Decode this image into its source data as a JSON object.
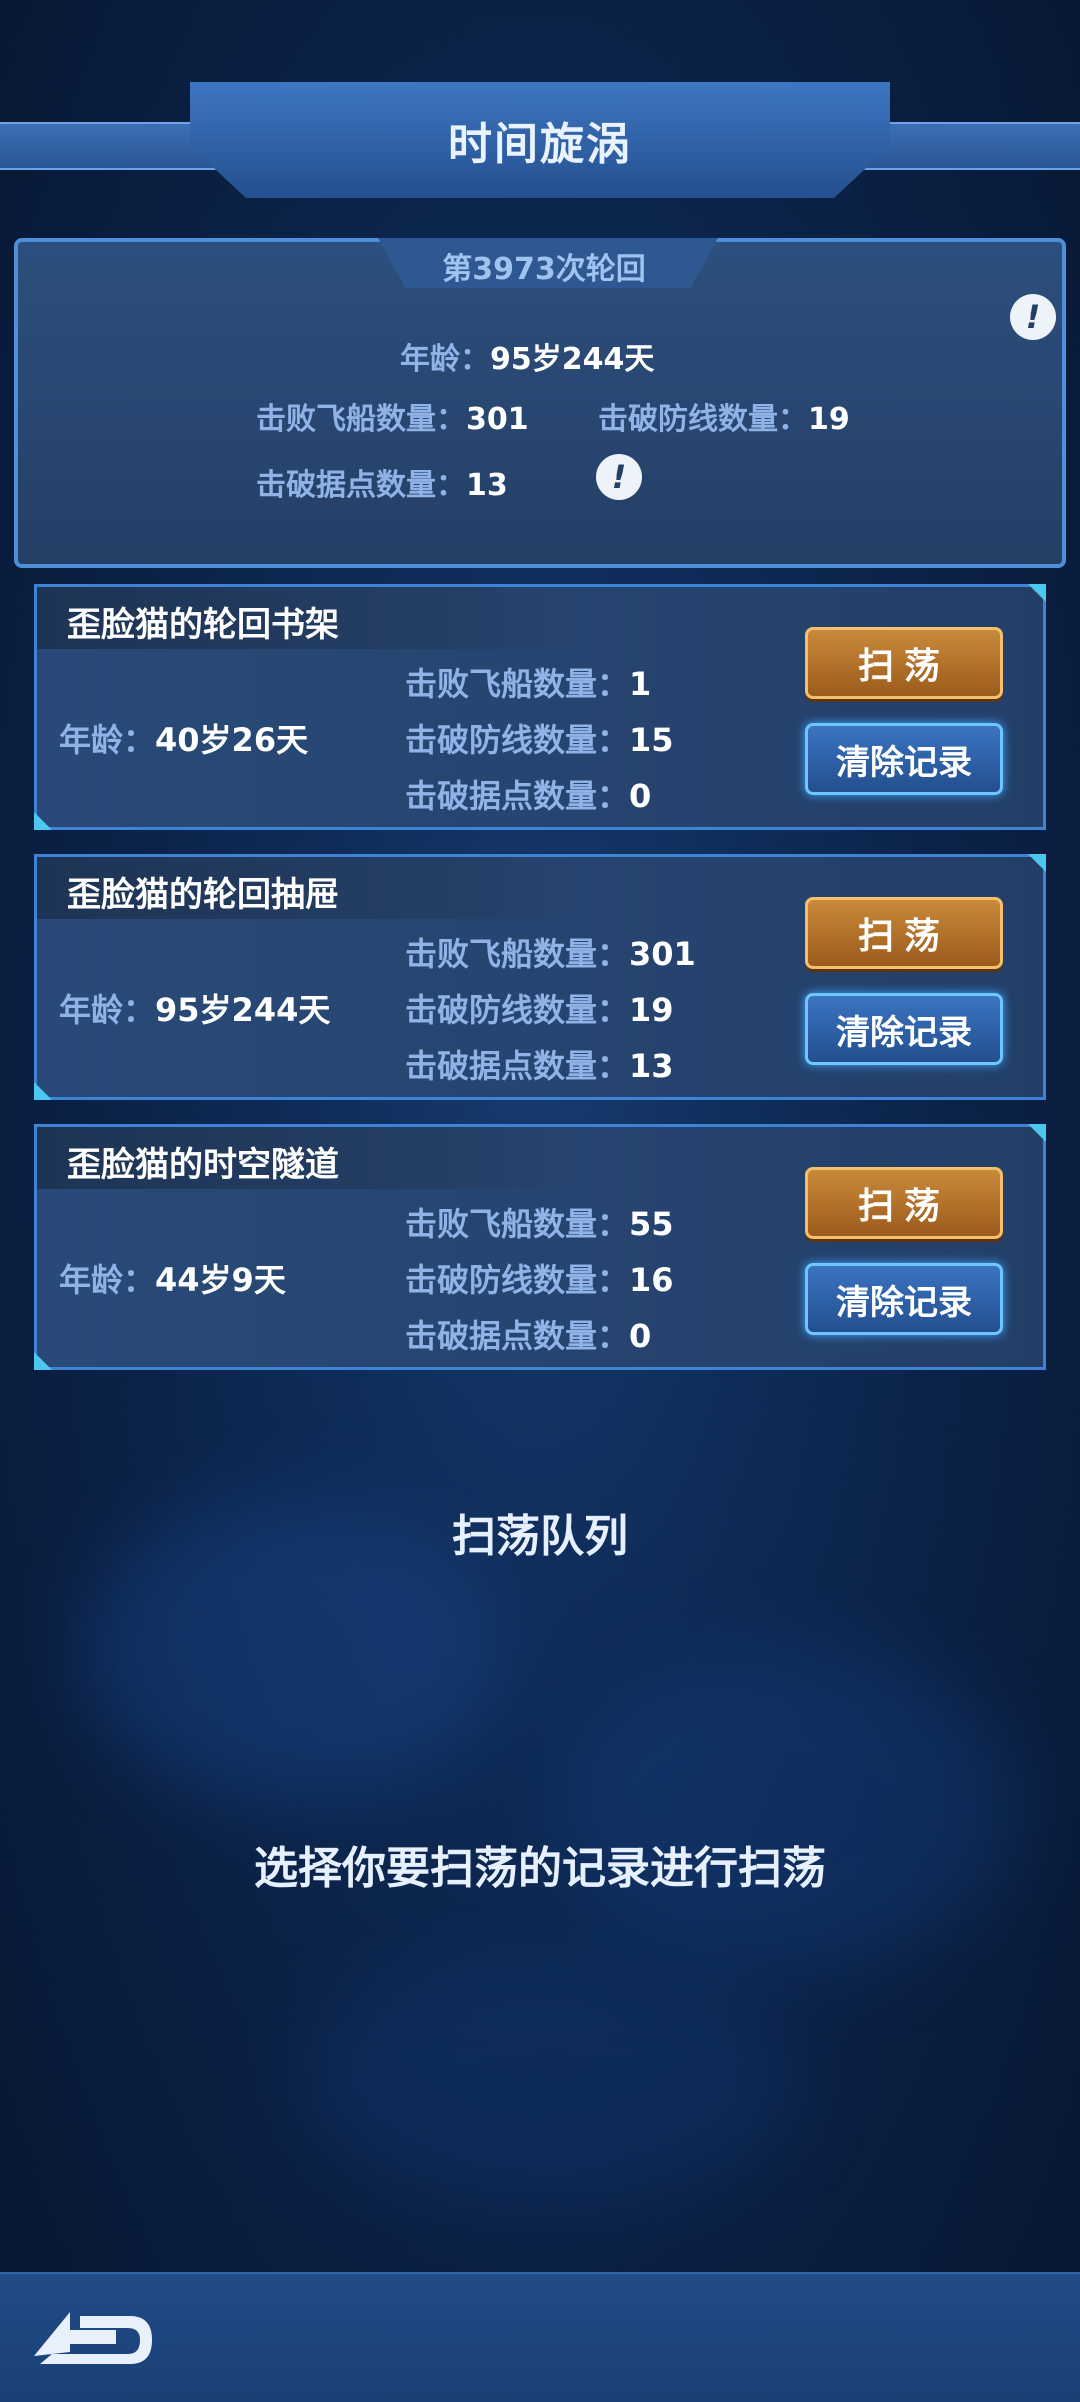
{
  "header": {
    "title": "时间旋涡"
  },
  "summary": {
    "round": "第3973次轮回",
    "age_label": "年龄：",
    "age_value": "95岁244天",
    "ships_label": "击败飞船数量：",
    "ships_value": "301",
    "lines_label": "击破防线数量：",
    "lines_value": "19",
    "bases_label": "击破据点数量：",
    "bases_value": "13",
    "info_icon": "exclamation-icon"
  },
  "records": [
    {
      "title": "歪脸猫的轮回书架",
      "age_label": "年龄：",
      "age": "40岁26天",
      "ships_label": "击败飞船数量：",
      "ships": "1",
      "lines_label": "击破防线数量：",
      "lines": "15",
      "bases_label": "击破据点数量：",
      "bases": "0",
      "sweep_label": "扫荡",
      "clear_label": "清除记录"
    },
    {
      "title": "歪脸猫的轮回抽屉",
      "age_label": "年龄：",
      "age": "95岁244天",
      "ships_label": "击败飞船数量：",
      "ships": "301",
      "lines_label": "击破防线数量：",
      "lines": "19",
      "bases_label": "击破据点数量：",
      "bases": "13",
      "sweep_label": "扫荡",
      "clear_label": "清除记录"
    },
    {
      "title": "歪脸猫的时空隧道",
      "age_label": "年龄：",
      "age": "44岁9天",
      "ships_label": "击败飞船数量：",
      "ships": "55",
      "lines_label": "击破防线数量：",
      "lines": "16",
      "bases_label": "击破据点数量：",
      "bases": "0",
      "sweep_label": "扫荡",
      "clear_label": "清除记录"
    }
  ],
  "queue": {
    "title": "扫荡队列",
    "hint": "选择你要扫荡的记录进行扫荡"
  },
  "footer": {
    "back_icon": "back-arrow-icon"
  },
  "colors": {
    "accent_gold": "#c98a3b",
    "accent_blue": "#3b74c0",
    "label_blue": "#8fb3e6"
  }
}
